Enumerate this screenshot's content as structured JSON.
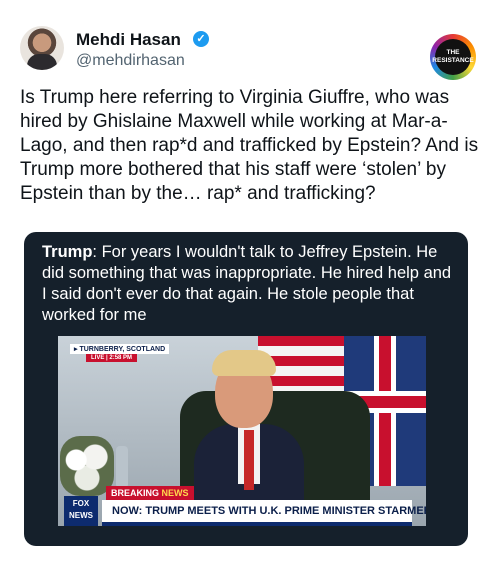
{
  "tweet": {
    "author": {
      "display_name": "Mehdi Hasan",
      "handle": "@mehdirhasan",
      "verified_icon": "verified-badge-icon"
    },
    "badge": {
      "line1": "THE",
      "line2": "RESISTANCE"
    },
    "text": "Is Trump here referring to Virginia Giuffre, who was hired by Ghislaine Maxwell while working at Mar-a-Lago, and then rap*d and trafficked by Epstein? And is Trump more bothered that his staff were ‘stolen’ by Epstein than by the… rap* and trafficking?"
  },
  "quote_card": {
    "speaker": "Trump",
    "text": ": For years I wouldn't talk to Jeffrey Epstein. He did something that was inappropriate. He hired help and I said don't ever do that again. He stole people that worked for me"
  },
  "video": {
    "location": "▸ TURNBERRY, SCOTLAND",
    "live": "LIVE",
    "live_time": "2:58 PM",
    "breaking_part1": "BREAKING",
    "breaking_part2": "NEWS",
    "network_line1": "FOX",
    "network_line2": "NEWS",
    "headline": "NOW: TRUMP MEETS WITH U.K. PRIME MINISTER STARMER"
  },
  "colors": {
    "card_bg": "#15202b",
    "verified": "#1d9bf0",
    "fox_red": "#c8102e",
    "fox_blue": "#0d2b6e"
  }
}
